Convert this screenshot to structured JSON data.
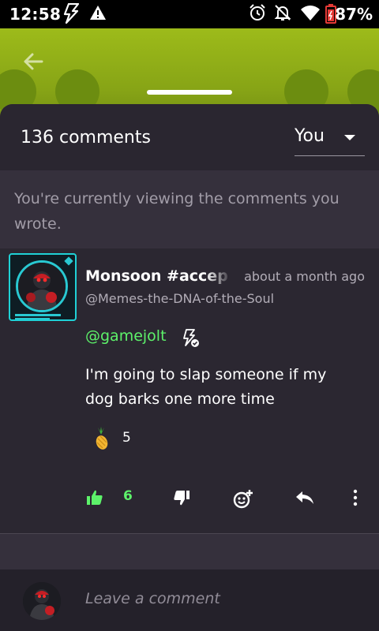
{
  "status_bar": {
    "time": "12:58",
    "battery": "87%",
    "icons": [
      "gamejolt-bolt-icon",
      "alert-triangle-icon",
      "alarm-icon",
      "mute-icon",
      "wifi-icon",
      "battery-icon"
    ]
  },
  "sheet": {
    "comment_count": "136 comments",
    "filter_value": "You",
    "notice": "You're currently viewing the comments you wrote."
  },
  "comment": {
    "author": "Monsoon #accepted",
    "timestamp": "about a month ago",
    "username": "@Memes-the-DNA-of-the-Soul",
    "mention": "@gamejolt",
    "body": "I'm going to slap someone if my dog barks one more time",
    "reaction_emoji": "pineapple-icon",
    "reaction_count": "5",
    "like_count": "6"
  },
  "compose": {
    "placeholder": "Leave a comment"
  },
  "colors": {
    "accent_green": "#5df26a",
    "sheet_bg": "#35303c",
    "header_bg": "#2a2630",
    "comment_bg": "#2b2731",
    "avatar_frame": "#1fd1d6"
  }
}
